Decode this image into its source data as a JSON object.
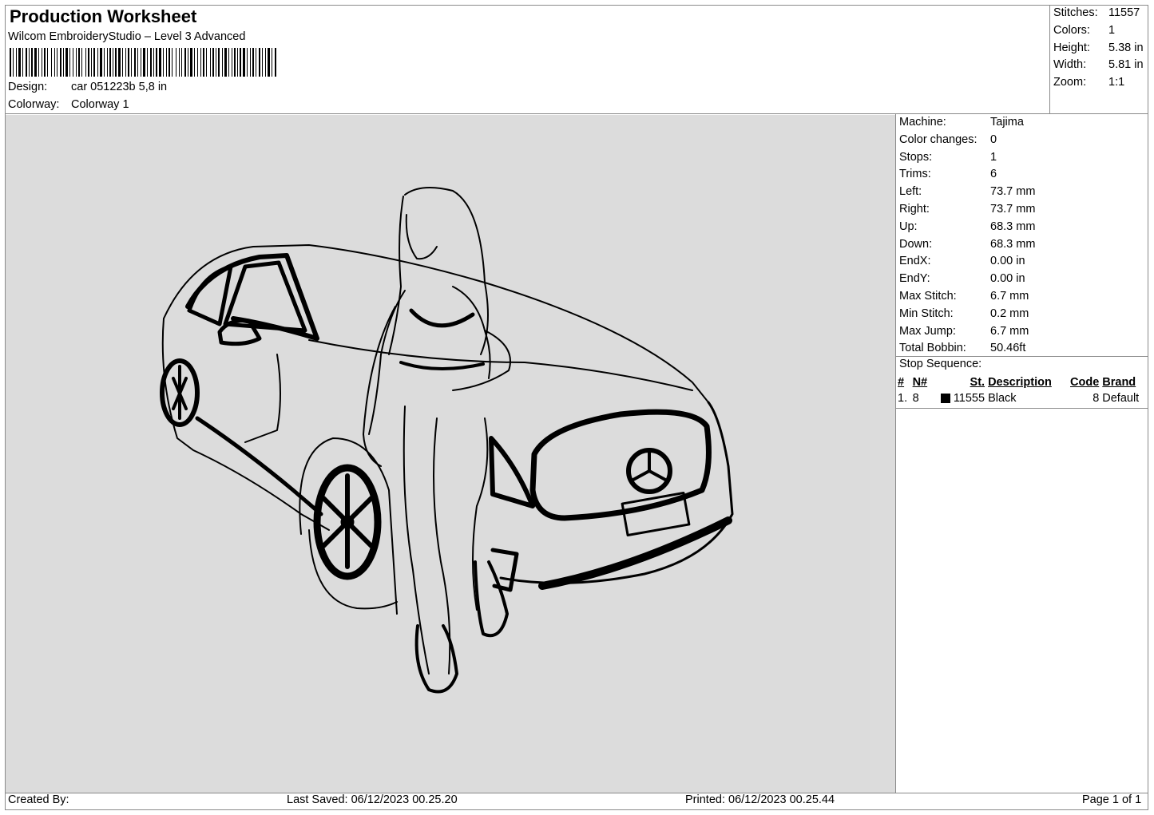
{
  "header": {
    "title": "Production Worksheet",
    "software": "Wilcom EmbroideryStudio – Level 3 Advanced",
    "design_label": "Design:",
    "design_value": "car 051223b 5,8 in",
    "colorway_label": "Colorway:",
    "colorway_value": "Colorway 1"
  },
  "summary": [
    {
      "label": "Stitches:",
      "value": "11557"
    },
    {
      "label": "Colors:",
      "value": "1"
    },
    {
      "label": "Height:",
      "value": "5.38 in"
    },
    {
      "label": "Width:",
      "value": "5.81 in"
    },
    {
      "label": "Zoom:",
      "value": "1:1"
    }
  ],
  "details": [
    {
      "label": "Machine:",
      "value": "Tajima"
    },
    {
      "label": "Color changes:",
      "value": "0"
    },
    {
      "label": "Stops:",
      "value": "1"
    },
    {
      "label": "Trims:",
      "value": "6"
    },
    {
      "label": "Left:",
      "value": "73.7 mm"
    },
    {
      "label": "Right:",
      "value": "73.7 mm"
    },
    {
      "label": "Up:",
      "value": "68.3 mm"
    },
    {
      "label": "Down:",
      "value": "68.3 mm"
    },
    {
      "label": "EndX:",
      "value": "0.00 in"
    },
    {
      "label": "EndY:",
      "value": "0.00 in"
    },
    {
      "label": "Max Stitch:",
      "value": "6.7 mm"
    },
    {
      "label": "Min Stitch:",
      "value": "0.2 mm"
    },
    {
      "label": "Max Jump:",
      "value": "6.7 mm"
    },
    {
      "label": "Total Bobbin:",
      "value": "50.46ft"
    }
  ],
  "stop_sequence": {
    "heading": "Stop Sequence:",
    "columns": [
      "#",
      "N#",
      "St.",
      "Description",
      "Code",
      "Brand"
    ],
    "rows": [
      {
        "index": "1.",
        "needle": "8",
        "swatch_color": "#000000",
        "stitches": "11555",
        "description": "Black",
        "code": "8",
        "brand": "Default"
      }
    ]
  },
  "footer": {
    "created_by": "Created By:",
    "last_saved": "Last Saved: 06/12/2023 00.25.20",
    "printed": "Printed: 06/12/2023 00.25.44",
    "page": "Page 1 of 1"
  },
  "colors": {
    "canvas_background": "#dcdcdc",
    "thread": "#000000",
    "border": "#8a8a8a"
  }
}
